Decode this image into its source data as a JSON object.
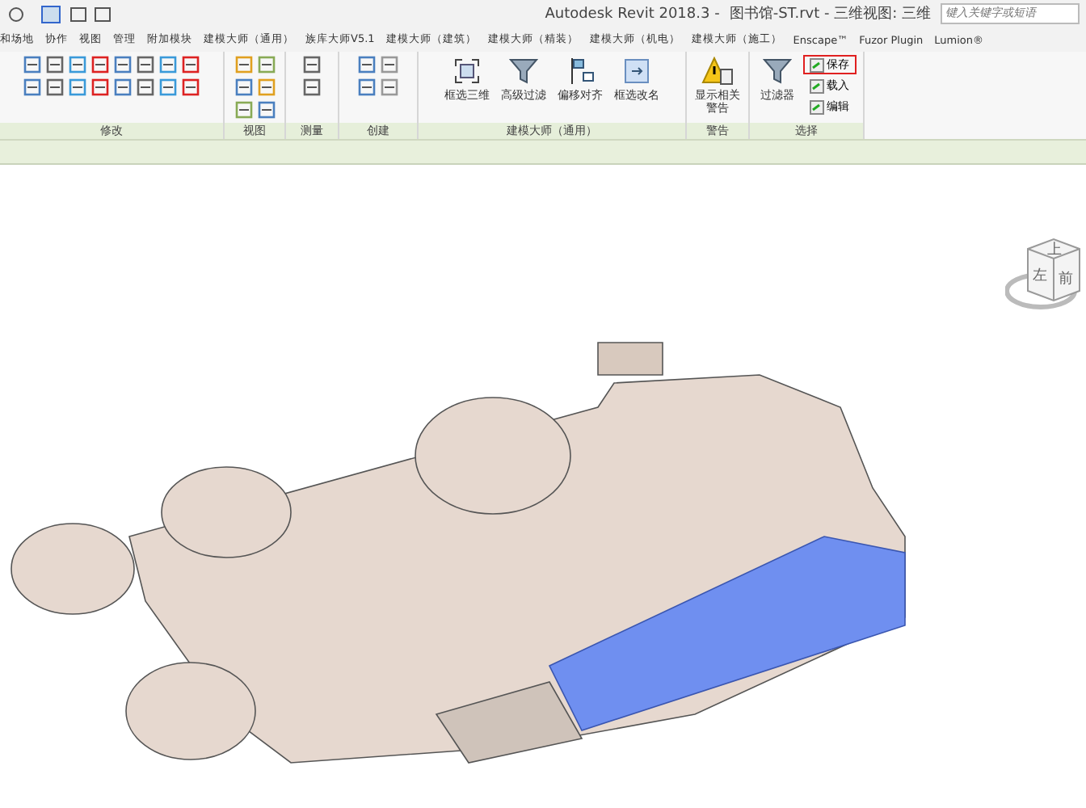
{
  "title_bar": {
    "app": "Autodesk Revit 2018.3 -",
    "document": "图书馆-ST.rvt - 三维视图: 三维",
    "search": {
      "placeholder": "键入关键字或短语"
    }
  },
  "tabs": [
    {
      "label": "和场地"
    },
    {
      "label": "协作"
    },
    {
      "label": "视图"
    },
    {
      "label": "管理"
    },
    {
      "label": "附加模块"
    },
    {
      "label": "建模大师（通用）"
    },
    {
      "label": "族库大师V5.1"
    },
    {
      "label": "建模大师（建筑）"
    },
    {
      "label": "建模大师（精装）"
    },
    {
      "label": "建模大师（机电）"
    },
    {
      "label": "建模大师（施工）"
    },
    {
      "label": "Enscape™"
    },
    {
      "label": "Fuzor Plugin"
    },
    {
      "label": "Lumion®"
    }
  ],
  "panels": [
    {
      "kind": "modify",
      "label": "修改"
    },
    {
      "kind": "view",
      "label": "视图"
    },
    {
      "kind": "measure",
      "label": "测量"
    },
    {
      "kind": "create",
      "label": "创建"
    },
    {
      "kind": "tools",
      "label": "建模大师（通用）",
      "buttons": [
        {
          "label": "框选三维"
        },
        {
          "label": "高级过滤"
        },
        {
          "label": "偏移对齐"
        },
        {
          "label": "框选改名"
        }
      ]
    },
    {
      "kind": "warning",
      "label": "警告",
      "buttons": [
        {
          "label": "显示相关警告"
        }
      ]
    },
    {
      "kind": "select",
      "label": "选择",
      "buttons": [
        {
          "label": "过滤器"
        }
      ],
      "small_buttons": [
        {
          "label": "保存",
          "highlighted": true
        },
        {
          "label": "载入",
          "highlighted": false
        },
        {
          "label": "编辑",
          "highlighted": false
        }
      ]
    }
  ],
  "view_cube": {
    "top": "上",
    "front": "前",
    "left": "左"
  }
}
